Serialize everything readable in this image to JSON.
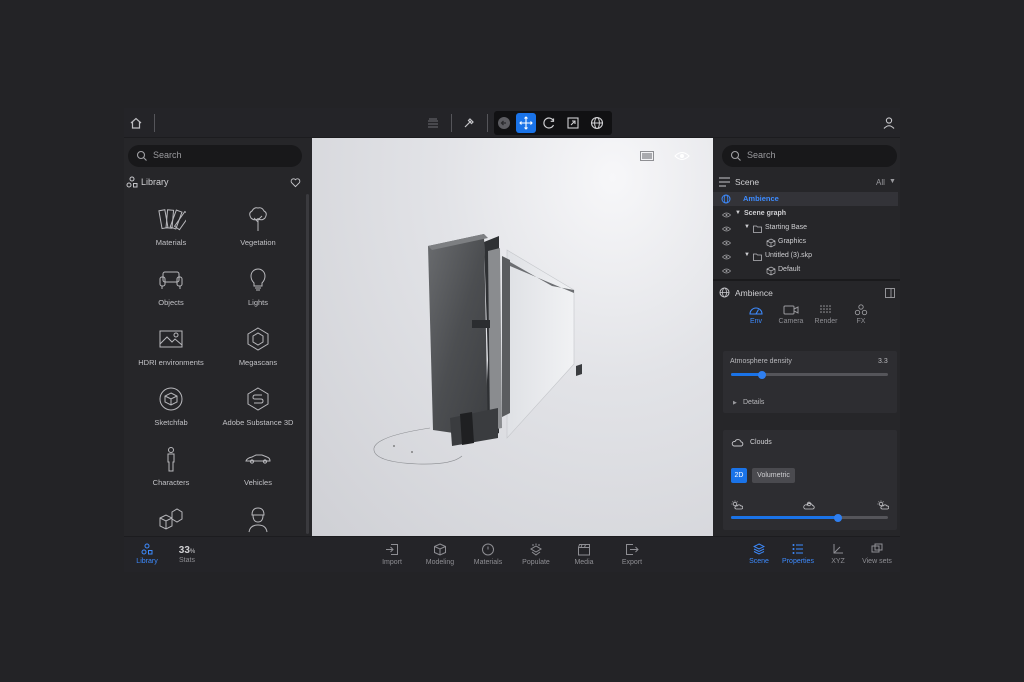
{
  "toolbar": {
    "tools": [
      "home-icon",
      "layers-icon",
      "picker-icon",
      "back-icon",
      "move-icon",
      "rotate-icon",
      "scale-icon",
      "globe-icon",
      "user-icon"
    ]
  },
  "left_panel": {
    "search_placeholder": "Search",
    "title": "Library",
    "items": [
      {
        "label": "Materials",
        "icon": "materials-icon"
      },
      {
        "label": "Vegetation",
        "icon": "tree-icon"
      },
      {
        "label": "Objects",
        "icon": "sofa-icon"
      },
      {
        "label": "Lights",
        "icon": "bulb-icon"
      },
      {
        "label": "HDRI environments",
        "icon": "hdri-icon"
      },
      {
        "label": "Megascans",
        "icon": "megascans-icon"
      },
      {
        "label": "Sketchfab",
        "icon": "sketchfab-icon"
      },
      {
        "label": "Adobe Substance 3D",
        "icon": "substance-icon"
      },
      {
        "label": "Characters",
        "icon": "person-icon"
      },
      {
        "label": "Vehicles",
        "icon": "car-icon"
      },
      {
        "label": "",
        "icon": "boxes-icon"
      },
      {
        "label": "",
        "icon": "worker-icon"
      }
    ]
  },
  "right_panel": {
    "search_placeholder": "Search",
    "scene_title": "Scene",
    "filter": "All",
    "tree": [
      {
        "label": "Ambience",
        "selected": true
      },
      {
        "label": "Scene graph"
      },
      {
        "label": "Starting Base"
      },
      {
        "label": "Graphics"
      },
      {
        "label": "Untitled (3).skp"
      },
      {
        "label": "Default"
      }
    ],
    "props_title": "Ambience",
    "tabs": [
      "Env",
      "Camera",
      "Render",
      "FX"
    ],
    "atmosphere": {
      "label": "Atmosphere density",
      "value": "3.3",
      "fraction": 0.2
    },
    "details": "Details",
    "clouds": {
      "label": "Clouds",
      "mode_2d": "2D",
      "mode_vol": "Volumetric",
      "fraction": 0.68
    }
  },
  "bottom": {
    "library": "Library",
    "stats_value": "33",
    "stats_unit": "%",
    "stats": "Stats",
    "center": [
      "Import",
      "Modeling",
      "Materials",
      "Populate",
      "Media",
      "Export"
    ],
    "right": [
      "Scene",
      "Properties",
      "XYZ",
      "View sets"
    ]
  },
  "colors": {
    "accent": "#1a73e8",
    "panel": "#262629",
    "bg": "#232326"
  }
}
